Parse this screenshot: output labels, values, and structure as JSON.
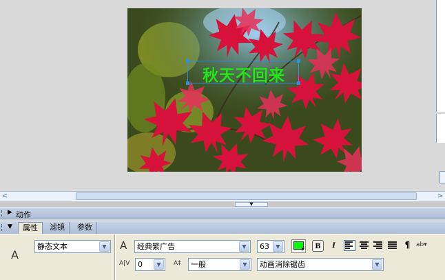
{
  "headline_text": "秋天不回来",
  "panels": {
    "actions_label": "动作",
    "tabs": [
      "属性",
      "滤镜",
      "参数"
    ]
  },
  "properties": {
    "text_type": "静态文本",
    "font_family": "经典繁广告",
    "font_size": "63",
    "letter_spacing": "0",
    "char_position": "一般",
    "anti_alias": "动画消除锯齿",
    "text_color": "#00ff00"
  },
  "icons": {
    "tool": "text-tool-icon",
    "font": "font-icon",
    "spacing": "letter-spacing-icon",
    "position": "char-position-icon",
    "bold": "bold-icon",
    "italic": "italic-icon",
    "align_left": "align-left-icon",
    "align_center": "align-center-icon",
    "align_right": "align-right-icon",
    "justify": "justify-icon",
    "paragraph": "paragraph-icon",
    "text_options": "text-options-icon"
  },
  "glyphs": {
    "big_a": "A",
    "font_a": "A",
    "spacing": "A|V",
    "position": "A‡",
    "bold": "B",
    "italic": "I",
    "paragraph": "¶",
    "text_options": "ab▾",
    "left_arrow": "<",
    "right_arrow": ">",
    "dropdown": "▼",
    "collapsed": "▶",
    "expanded": "▼"
  }
}
